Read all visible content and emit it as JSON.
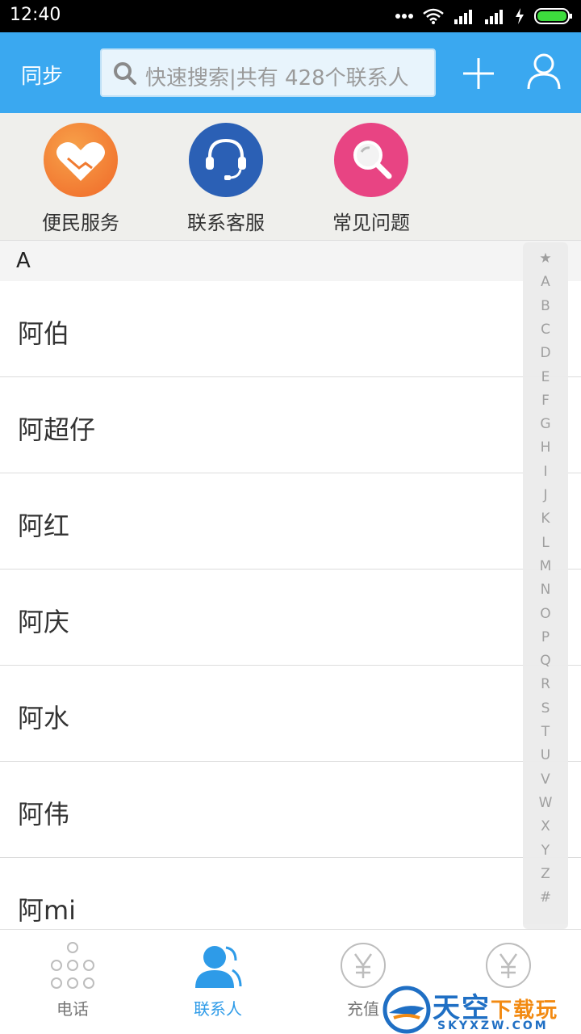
{
  "status_bar": {
    "time": "12:40"
  },
  "header": {
    "sync_label": "同步",
    "search_placeholder": "快速搜索|共有 428个联系人",
    "add_icon": "plus-icon",
    "profile_icon": "user-icon"
  },
  "services": [
    {
      "label": "便民服务",
      "icon": "handshake-heart-icon",
      "color": "#f5792e"
    },
    {
      "label": "联系客服",
      "icon": "headset-icon",
      "color": "#2b60b5"
    },
    {
      "label": "常见问题",
      "icon": "magnifier-icon",
      "color": "#e84483"
    }
  ],
  "contacts": {
    "section_letter": "A",
    "items": [
      "阿伯",
      "阿超仔",
      "阿红",
      "阿庆",
      "阿水",
      "阿伟",
      "阿mi"
    ]
  },
  "alpha_index": [
    "★",
    "A",
    "B",
    "C",
    "D",
    "E",
    "F",
    "G",
    "H",
    "I",
    "J",
    "K",
    "L",
    "M",
    "N",
    "O",
    "P",
    "Q",
    "R",
    "S",
    "T",
    "U",
    "V",
    "W",
    "X",
    "Y",
    "Z",
    "#"
  ],
  "bottom_nav": [
    {
      "label": "电话",
      "icon": "dialpad-icon",
      "active": false
    },
    {
      "label": "联系人",
      "icon": "contacts-icon",
      "active": true
    },
    {
      "label": "充值",
      "icon": "yen-icon",
      "active": false
    },
    {
      "label": "",
      "icon": "yen-icon",
      "active": false
    }
  ],
  "watermark": {
    "title_main": "天空",
    "title_accent": "下载玩",
    "subtitle": "SKYXZW.COM"
  },
  "colors": {
    "header": "#3aa8f0",
    "active_tab": "#2e9be8"
  }
}
